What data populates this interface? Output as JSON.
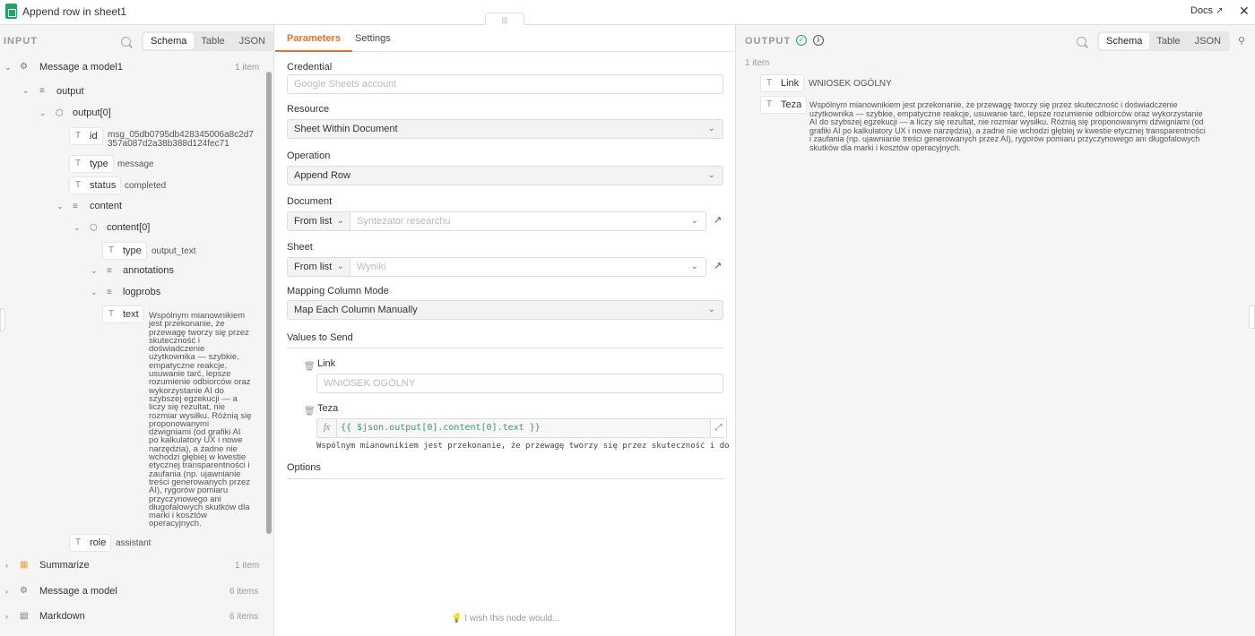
{
  "topbar": {
    "title": "Append row in sheet1",
    "docs": "Docs",
    "close": "✕"
  },
  "input": {
    "label": "INPUT",
    "tabs": [
      "Schema",
      "Table",
      "JSON"
    ],
    "node": {
      "name": "Message a model1",
      "count": "1 item"
    },
    "tree": {
      "output": "output",
      "output0": "output[0]",
      "id_key": "id",
      "id_val1": "msg_05db0795db428345006a8c2d7",
      "id_val2": "357a087d2a38b388d124fec71",
      "type_key": "type",
      "type_val": "message",
      "status_key": "status",
      "status_val": "completed",
      "content": "content",
      "content0": "content[0]",
      "ctype_key": "type",
      "ctype_val": "output_text",
      "annotations": "annotations",
      "logprobs": "logprobs",
      "text_key": "text",
      "text_lines": [
        "Wspólnym mianownikiem",
        "jest przekonanie, że",
        "przewagę tworzy się przez",
        "skuteczność i",
        "doświadczenie",
        "użytkownika — szybkie,",
        "empatyczne reakcje,",
        "usuwanie tarć, lepsze",
        "rozumienie odbiorców oraz",
        "wykorzystanie AI do",
        "szybszej egzekucji — a",
        "liczy się rezultat, nie",
        "rozmiar wysiłku. Różnią się",
        "proponowanymi",
        "dźwigniami (od grafiki AI",
        "po kalkulatory UX i nowe",
        "narzędzia), a żadne nie",
        "wchodzi głębiej w kwestie",
        "etycznej transparentności i",
        "zaufania (np. ujawnianie",
        "treści generowanych przez",
        "AI), rygorów pomiaru",
        "przyczynowego ani",
        "długofalowych skutków dla",
        "marki i kosztów",
        "operacyjnych."
      ],
      "role_key": "role",
      "role_val": "assistant"
    },
    "other_nodes": [
      {
        "name": "Summarize",
        "count": "1 item"
      },
      {
        "name": "Message a model",
        "count": "6 items"
      },
      {
        "name": "Markdown",
        "count": "6 items"
      }
    ]
  },
  "params": {
    "tabs": [
      "Parameters",
      "Settings"
    ],
    "credential_label": "Credential",
    "credential_ph": "Google Sheets account",
    "resource_label": "Resource",
    "resource_val": "Sheet Within Document",
    "operation_label": "Operation",
    "operation_val": "Append Row",
    "document_label": "Document",
    "document_mode": "From list",
    "document_ph": "Syntezator researchu",
    "sheet_label": "Sheet",
    "sheet_mode": "From list",
    "sheet_ph": "Wyniki",
    "mapping_label": "Mapping Column Mode",
    "mapping_val": "Map Each Column Manually",
    "values_label": "Values to Send",
    "link_label": "Link",
    "link_ph": "WNIOSEK OGÓLNY",
    "teza_label": "Teza",
    "teza_expr": "{{ $json.output[0].content[0].text }}",
    "teza_preview": "Wspólnym mianownikiem jest przekonanie, że przewagę tworzy się przez skuteczność i doświ…",
    "options_label": "Options",
    "footer": "I wish this node would..."
  },
  "output": {
    "label": "OUTPUT",
    "count": "1 item",
    "tabs": [
      "Schema",
      "Table",
      "JSON"
    ],
    "link_key": "Link",
    "link_val": "WNIOSEK OGÓLNY",
    "teza_key": "Teza",
    "teza_lines": [
      "Wspólnym mianownikiem jest przekonanie, że przewagę tworzy się przez skuteczność i doświadczenie",
      "użytkownika — szybkie, empatyczne reakcje, usuwanie tarć, lepsze rozumienie odbiorców oraz wykorzystanie",
      "AI do szybszej egzekucji — a liczy się rezultat, nie rozmiar wysiłku. Różnią się proponowanymi dźwigniami (od",
      "grafiki AI po kalkulatory UX i nowe narzędzia), a żadne nie wchodzi głębiej w kwestie etycznej transparentności",
      "i zaufania (np. ujawnianie treści generowanych przez AI), rygorów pomiaru przyczynowego ani długofalowych",
      "skutków dla marki i kosztów operacyjnych."
    ]
  },
  "colors": {
    "accent": "#e8702a",
    "success": "#29a36a",
    "sheets": "#1fa463"
  }
}
